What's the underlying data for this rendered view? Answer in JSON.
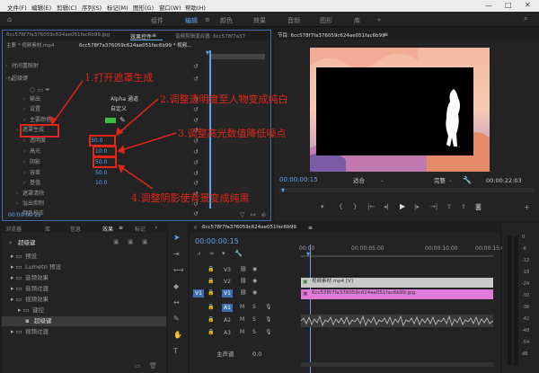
{
  "menu": [
    "文件(F)",
    "编辑(E)",
    "剪辑(C)",
    "序列(S)",
    "标记(M)",
    "图形(G)",
    "窗口(W)",
    "帮助(H)"
  ],
  "workspaces": [
    "组件",
    "编辑",
    "颜色",
    "效果",
    "音频",
    "图形",
    "库"
  ],
  "source_tab": "6cc578f7fa376059c624ae051fac6b99.jpg",
  "effect_controls_tab": "效果控件",
  "audio_mixer_tab": "音频剪辑混合器: 6cc578f7a37",
  "ec_header": {
    "master": "主要 * 视频素材.mp4",
    "clip": "6cc578f7a376059c624ae051fac6b99 * 视频..."
  },
  "ec_rows": [
    {
      "label": "时间重映射"
    },
    {
      "label": "超级键"
    },
    {
      "label": "输出",
      "value": "Alpha 通道"
    },
    {
      "label": "设置",
      "value": "自定义"
    },
    {
      "label": "主要颜色"
    },
    {
      "label": "遮罩生成"
    },
    {
      "label": "透明度",
      "value": "30.0"
    },
    {
      "label": "高光",
      "value": "10.0"
    },
    {
      "label": "阴影",
      "value": "50.0"
    },
    {
      "label": "容差",
      "value": "50.0"
    },
    {
      "label": "基值",
      "value": "10.0"
    },
    {
      "label": "遮罩清除"
    },
    {
      "label": "溢出抑制"
    },
    {
      "label": "颜色校正"
    }
  ],
  "ec_time": "00:00:00:15",
  "annotations": [
    "1.打开遮罩生成",
    "2.调整透明度至人物变成纯白",
    "3.调整高光数值降低噪点",
    "4.调整阴影使背景变成纯黑"
  ],
  "program": {
    "tab": "节目: 6cc578f7fa376059c624ae051fac6b99",
    "timecode": "00:00:00:15",
    "fit": "适合",
    "quality": "完整",
    "duration": "00:00:22:03"
  },
  "project": {
    "tabs": [
      "浏览器",
      "库",
      "信息",
      "效果",
      "标记"
    ],
    "search": "超级键",
    "items": [
      "预设",
      "Lumetri 预设",
      "音频效果",
      "音频过渡",
      "视频效果",
      "键控",
      "超级键",
      "视频过渡"
    ]
  },
  "timeline": {
    "tab": "6cc578f7fa376059c624ae051fac6b99",
    "timecode": "00:00:00:15",
    "ruler": [
      "00:00",
      "00:00:05:00",
      "00:00:10:00",
      "00:00:15:00"
    ],
    "tracks": [
      "V3",
      "V2",
      "V1",
      "A1",
      "A2",
      "A3"
    ],
    "clip_v2": "视频素材.mp4 [V]",
    "clip_v1": "6cc578f7fa376059c624ae051fac6b99.jpg",
    "master": "主声道",
    "master_val": "0.0"
  },
  "colors": {
    "accent": "#5fa3f2",
    "annotation": "#e0261a",
    "clip_pink": "#e07ad8",
    "clip_gray": "#c9c9c9"
  },
  "audio_meter": [
    "0",
    "-6",
    "-12",
    "-18",
    "-24",
    "-30",
    "-36",
    "-42",
    "-48",
    "-54",
    "dB"
  ]
}
